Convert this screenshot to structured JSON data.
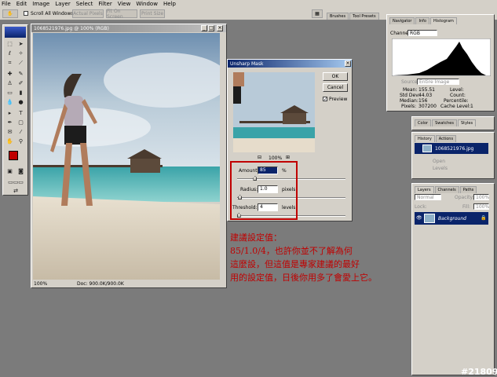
{
  "menu": [
    "File",
    "Edit",
    "Image",
    "Layer",
    "Select",
    "Filter",
    "View",
    "Window",
    "Help"
  ],
  "options_bar": {
    "scroll_all": "Scroll All Windows",
    "buttons": [
      "Actual Pixels",
      "Fit On Screen",
      "Print Size"
    ],
    "palette_tabs": [
      "Brushes",
      "Tool Presets"
    ]
  },
  "document": {
    "title": "1068521976.jpg @ 100% (RGB)",
    "zoom": "100%",
    "doc_size": "Doc: 900.0K/900.0K"
  },
  "unsharp": {
    "title": "Unsharp Mask",
    "ok": "OK",
    "cancel": "Cancel",
    "preview": "Preview",
    "preview_zoom": "100%",
    "amount_label": "Amount:",
    "amount_value": "85",
    "amount_unit": "%",
    "radius_label": "Radius:",
    "radius_value": "1.0",
    "radius_unit": "pixels",
    "threshold_label": "Threshold:",
    "threshold_value": "4",
    "threshold_unit": "levels",
    "amount_frac": 0.17,
    "radius_frac": 0.03,
    "threshold_frac": 0.02
  },
  "note": {
    "line1": "建議設定值：",
    "line2": "85/1.0/4，也許你並不了解為何",
    "line3": "這麼設，但這值是專家建議的最好",
    "line4": "用的設定值，日後你用多了會愛上它。"
  },
  "histogram": {
    "tabs": [
      "Navigator",
      "Info",
      "Histogram"
    ],
    "channel_label": "Channel:",
    "channel_value": "RGB",
    "source_label": "Source:",
    "source_value": "Entire Image",
    "mean_label": "Mean:",
    "mean_value": "155.51",
    "std_label": "Std Dev:",
    "std_value": "44.03",
    "median_label": "Median:",
    "median_value": "156",
    "pixels_label": "Pixels:",
    "pixels_value": "307200",
    "level_label": "Level:",
    "count_label": "Count:",
    "percentile_label": "Percentile:",
    "cache_label": "Cache Level:",
    "cache_value": "1"
  },
  "color_tabs": [
    "Color",
    "Swatches",
    "Styles"
  ],
  "history": {
    "tabs": [
      "History",
      "Actions"
    ],
    "snapshot": "1068521976.jpg",
    "items": [
      "Open",
      "Levels"
    ]
  },
  "layers": {
    "tabs": [
      "Layers",
      "Channels",
      "Paths"
    ],
    "blend": "Normal",
    "opacity_label": "Opacity:",
    "opacity": "100%",
    "lock_label": "Lock:",
    "fill_label": "Fill:",
    "fill": "100%",
    "layer_name": "Background"
  },
  "watermark": "#21809",
  "colors": {
    "accent": "#0a246a",
    "note": "#c00000",
    "highlight": "#c00000"
  }
}
